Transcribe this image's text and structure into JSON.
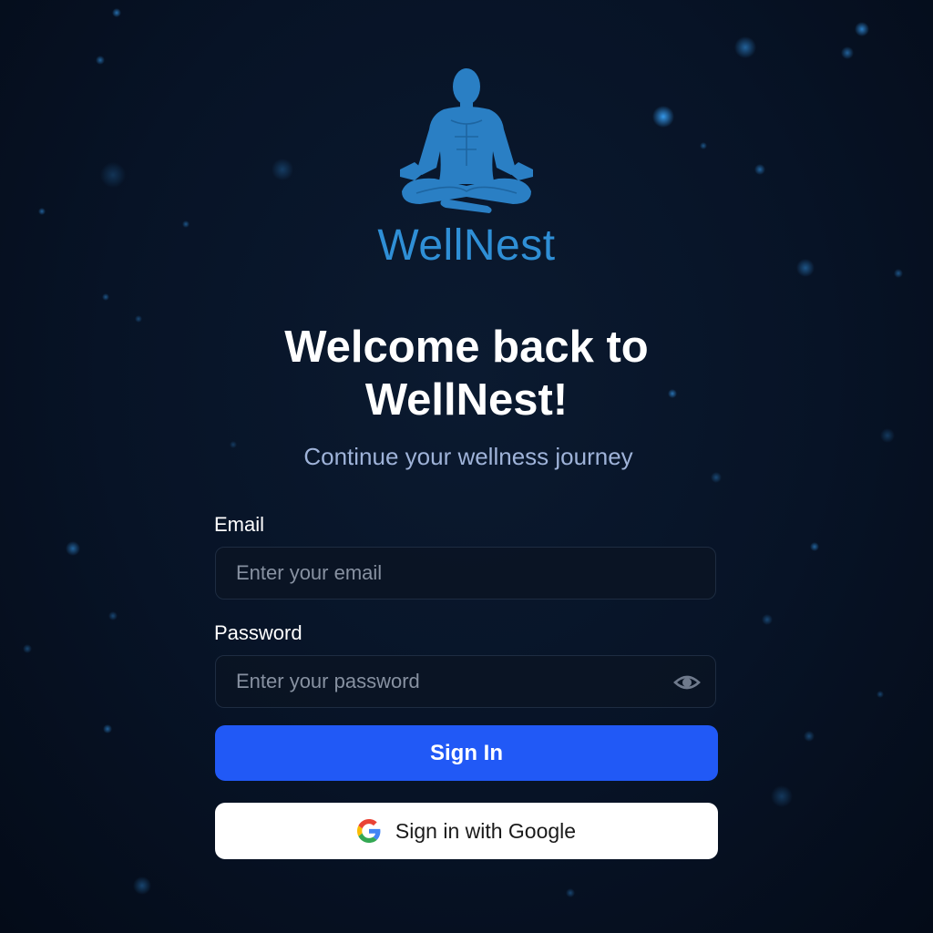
{
  "brand": {
    "name": "WellNest",
    "logo_icon": "meditation-figure-icon"
  },
  "heading": {
    "line1": "Welcome back to",
    "line2": "WellNest!"
  },
  "subtitle": "Continue your wellness journey",
  "form": {
    "email": {
      "label": "Email",
      "placeholder": "Enter your email",
      "value": ""
    },
    "password": {
      "label": "Password",
      "placeholder": "Enter your password",
      "value": "",
      "toggle_icon": "eye-icon"
    },
    "sign_in_label": "Sign In",
    "google": {
      "label": "Sign in with Google",
      "icon": "google-icon"
    }
  },
  "colors": {
    "background": "#071326",
    "brand": "#2f8fd6",
    "logo_figure": "#2a7fc4",
    "subtitle": "#9fb3d9",
    "primary_button": "#2159f6",
    "google_button": "#ffffff"
  }
}
